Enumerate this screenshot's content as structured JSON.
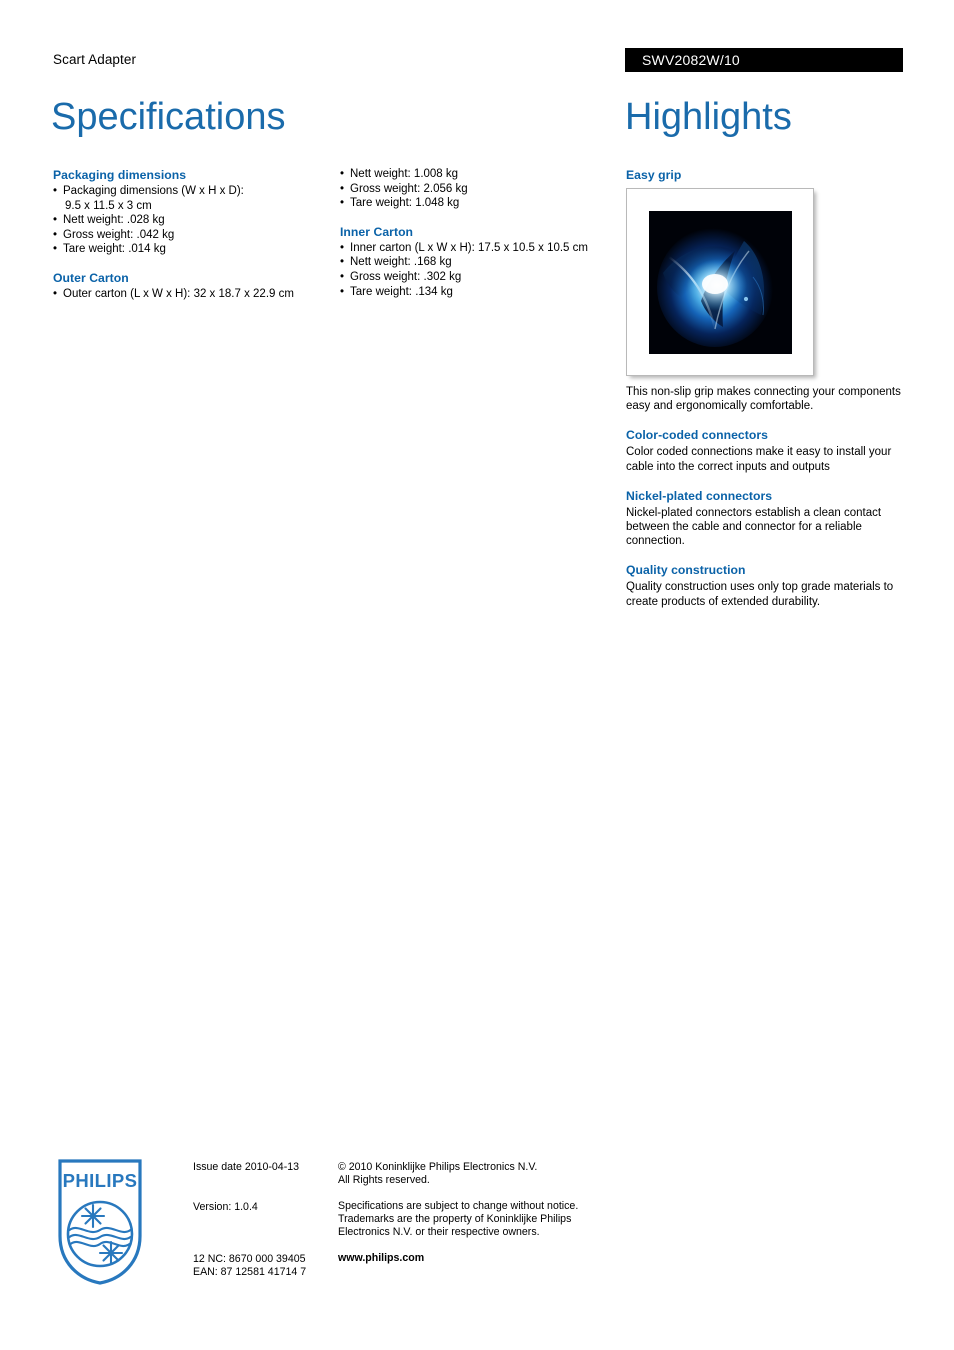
{
  "header": {
    "product_name": "Scart Adapter",
    "product_code": "SWV2082W/10"
  },
  "titles": {
    "specifications": "Specifications",
    "highlights": "Highlights"
  },
  "colors": {
    "heading_blue": "#0a62a8",
    "title_blue": "#1a6bab",
    "code_bar_bg": "#000000",
    "logo_blue": "#2878be"
  },
  "specifications": {
    "column1": [
      {
        "heading": "Packaging dimensions",
        "items": [
          {
            "text": "Packaging dimensions (W x H x D):",
            "continuation": "9.5 x 11.5 x 3 cm"
          },
          {
            "text": "Nett weight: .028 kg"
          },
          {
            "text": "Gross weight: .042 kg"
          },
          {
            "text": "Tare weight: .014 kg"
          }
        ]
      },
      {
        "heading": "Outer Carton",
        "items": [
          {
            "text": "Outer carton (L x W x H): 32 x 18.7 x 22.9 cm"
          }
        ]
      }
    ],
    "column2": [
      {
        "heading": "",
        "items": [
          {
            "text": "Nett weight: 1.008 kg"
          },
          {
            "text": "Gross weight: 2.056 kg"
          },
          {
            "text": "Tare weight: 1.048 kg"
          }
        ]
      },
      {
        "heading": "Inner Carton",
        "items": [
          {
            "text": "Inner carton (L x W x H): 17.5 x 10.5 x 10.5 cm"
          },
          {
            "text": "Nett weight: .168 kg"
          },
          {
            "text": "Gross weight: .302 kg"
          },
          {
            "text": "Tare weight: .134 kg"
          }
        ]
      }
    ],
    "bullet_glyph": "•"
  },
  "highlights": [
    {
      "title": "Easy grip",
      "has_image": true,
      "image_alt": "product-photo-blue-glow",
      "text": "This non-slip grip makes connecting your components easy and ergonomically comfortable."
    },
    {
      "title": "Color-coded connectors",
      "has_image": false,
      "text": "Color coded connections make it easy to install your cable into the correct inputs and outputs"
    },
    {
      "title": "Nickel-plated connectors",
      "has_image": false,
      "text": "Nickel-plated connectors establish a clean contact between the cable and connector for a reliable connection."
    },
    {
      "title": "Quality construction",
      "has_image": false,
      "text": "Quality construction uses only top grade materials to create products of extended durability."
    }
  ],
  "footer": {
    "logo_wordmark": "PHILIPS",
    "issue_date": "Issue date 2010-04-13",
    "version": "Version: 1.0.4",
    "twelve_nc": "12 NC: 8670 000 39405",
    "ean": "EAN: 87 12581 41714 7",
    "copyright_line1": "© 2010 Koninklijke Philips Electronics N.V.",
    "copyright_line2": "All Rights reserved.",
    "disclaimer": "Specifications are subject to change without notice. Trademarks are the property of Koninklijke Philips Electronics N.V. or their respective owners.",
    "website": "www.philips.com"
  }
}
